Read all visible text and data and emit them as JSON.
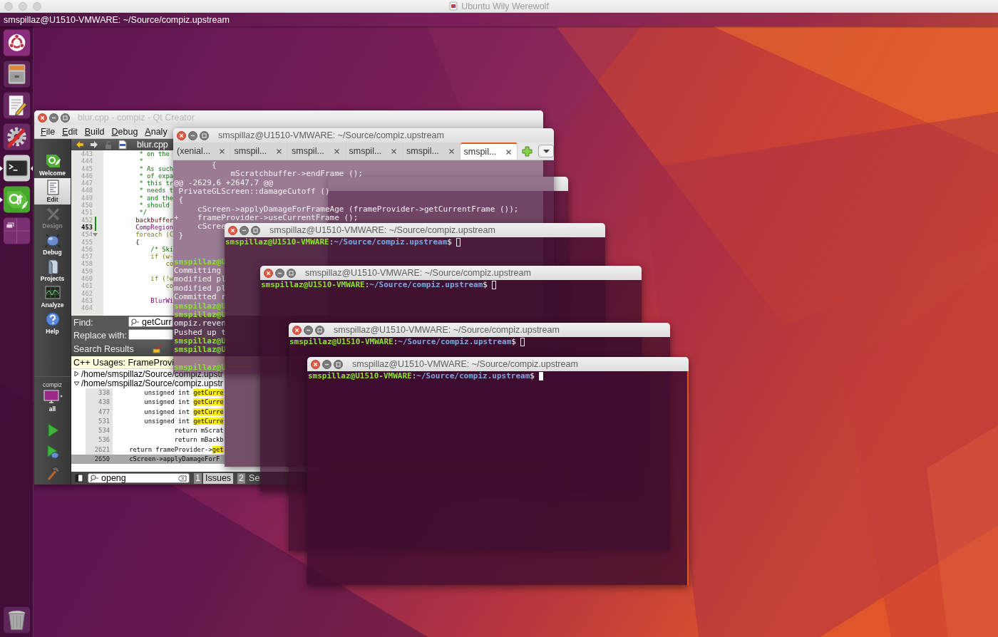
{
  "host_window": {
    "title": "Ubuntu Wily Werewolf"
  },
  "top_panel": {
    "title": "smspillaz@U1510-VMWARE: ~/Source/compiz.upstream"
  },
  "launcher": {
    "items": [
      {
        "kind": "ubuntu",
        "running": false,
        "focused": false
      },
      {
        "kind": "files",
        "running": false,
        "focused": false
      },
      {
        "kind": "text_editor",
        "running": false,
        "focused": false
      },
      {
        "kind": "settings",
        "running": false,
        "focused": false
      },
      {
        "kind": "terminal",
        "running": true,
        "focused": true
      },
      {
        "kind": "qt",
        "running": true,
        "focused": false
      },
      {
        "kind": "workspaces",
        "running": false,
        "focused": false
      },
      {
        "kind": "trash",
        "running": false,
        "focused": false
      }
    ]
  },
  "windows": [
    {
      "kind": "qt_creator",
      "title": "blur.cpp - compiz - Qt Creator",
      "menu": [
        "File",
        "Edit",
        "Build",
        "Debug",
        "Analy"
      ],
      "modes": [
        {
          "kind": "welcome",
          "label": "Welcome",
          "selected": false,
          "disabled": false
        },
        {
          "kind": "edit",
          "label": "Edit",
          "selected": true,
          "disabled": false
        },
        {
          "kind": "design",
          "label": "Design",
          "selected": false,
          "disabled": true
        },
        {
          "kind": "debug",
          "label": "Debug",
          "selected": false,
          "disabled": false
        },
        {
          "kind": "projects",
          "label": "Projects",
          "selected": false,
          "disabled": false
        },
        {
          "kind": "analyze",
          "label": "Analyze",
          "selected": false,
          "disabled": false
        },
        {
          "kind": "help",
          "label": "Help",
          "selected": false,
          "disabled": false
        }
      ],
      "kit": {
        "project": "compiz",
        "build": "all"
      },
      "actions": [
        {
          "kind": "run"
        },
        {
          "kind": "debug_run"
        },
        {
          "kind": "build"
        }
      ],
      "editor": {
        "file": "blur.cpp",
        "lines": [
          {
            "number": "443",
            "text": "     * on the",
            "kind": "comment",
            "current": false,
            "changed": false,
            "foldable": false
          },
          {
            "number": "444",
            "text": "     *",
            "kind": "comment",
            "current": false,
            "changed": false,
            "foldable": false
          },
          {
            "number": "445",
            "text": "     * As such",
            "kind": "comment",
            "current": false,
            "changed": false,
            "foldable": false
          },
          {
            "number": "446",
            "text": "     * of expa",
            "kind": "comment",
            "current": false,
            "changed": false,
            "foldable": false
          },
          {
            "number": "447",
            "text": "     * this tr",
            "kind": "comment",
            "current": false,
            "changed": false,
            "foldable": false
          },
          {
            "number": "448",
            "text": "     * needs t",
            "kind": "comment",
            "current": false,
            "changed": false,
            "foldable": false
          },
          {
            "number": "449",
            "text": "     * and the",
            "kind": "comment",
            "current": false,
            "changed": false,
            "foldable": false
          },
          {
            "number": "450",
            "text": "     * should",
            "kind": "comment",
            "current": false,
            "changed": false,
            "foldable": false
          },
          {
            "number": "451",
            "text": "     */",
            "kind": "comment",
            "current": false,
            "changed": false,
            "foldable": false
          },
          {
            "number": "452",
            "text": "    backbuffer",
            "kind": "member",
            "current": false,
            "changed": true,
            "foldable": false
          },
          {
            "number": "453",
            "text": "    CompRegion",
            "kind": "type",
            "current": true,
            "changed": true,
            "foldable": false
          },
          {
            "number": "454",
            "text": "    foreach (C",
            "kind": "keyword",
            "current": false,
            "changed": false,
            "foldable": true
          },
          {
            "number": "455",
            "text": "    {",
            "kind": "plain",
            "current": false,
            "changed": false,
            "foldable": false
          },
          {
            "number": "456",
            "text": "        /* Ski",
            "kind": "comment",
            "current": false,
            "changed": false,
            "foldable": false
          },
          {
            "number": "457",
            "text": "        if (w-",
            "kind": "keyword",
            "current": false,
            "changed": false,
            "foldable": false
          },
          {
            "number": "458",
            "text": "            co",
            "kind": "keyword",
            "current": false,
            "changed": false,
            "foldable": false
          },
          {
            "number": "459",
            "kind": "plain",
            "current": false,
            "changed": false,
            "foldable": false
          },
          {
            "number": "460",
            "text": "        if (!w",
            "kind": "keyword",
            "current": false,
            "changed": false,
            "foldable": false
          },
          {
            "number": "461",
            "text": "            co",
            "kind": "keyword",
            "current": false,
            "changed": false,
            "foldable": false
          },
          {
            "number": "462",
            "kind": "plain",
            "current": false,
            "changed": false,
            "foldable": false
          },
          {
            "number": "463",
            "text": "        BlurWi",
            "kind": "type",
            "current": false,
            "changed": false,
            "foldable": false
          },
          {
            "number": "464",
            "kind": "plain",
            "current": false,
            "changed": false,
            "foldable": false
          }
        ]
      },
      "find": {
        "label": "Find:",
        "value": "getCurr"
      },
      "replace": {
        "label": "Replace with:"
      },
      "search_results": {
        "title": "Search Results",
        "query": "C++ Usages: FrameProvi",
        "files": [
          {
            "path": "/home/smspillaz/Source/compiz.upstr",
            "expanded": false
          },
          {
            "path": "/home/smspillaz/Source/compiz.upstr",
            "expanded": true,
            "matches": [
              {
                "line": "338",
                "code": "        unsigned int ",
                "match": "getCurre",
                "selected": false
              },
              {
                "line": "438",
                "code": "        unsigned int ",
                "match": "getCurre",
                "selected": false
              },
              {
                "line": "477",
                "code": "        unsigned int ",
                "match": "getCurre",
                "selected": false
              },
              {
                "line": "531",
                "code": "        unsigned int ",
                "match": "getCurre",
                "selected": false
              },
              {
                "line": "534",
                "code": "                return mScrat",
                "selected": false
              },
              {
                "line": "536",
                "code": "                return mBackb",
                "selected": false
              },
              {
                "line": "2621",
                "code": "    return frameProvider->",
                "match": "get",
                "selected": false
              },
              {
                "line": "2650",
                "code": "    cScreen->applyDamageForF",
                "selected": true
              }
            ]
          }
        ]
      },
      "output_bar": {
        "filter": "openg",
        "panes": [
          {
            "number": "1",
            "label": "Issues",
            "selected": true
          },
          {
            "number": "2",
            "label": "Se",
            "selected": false
          }
        ]
      }
    },
    {
      "kind": "frame"
    },
    {
      "kind": "tabbed_terminal",
      "title": "smspillaz@U1510-VMWARE: ~/Source/compiz.upstream",
      "tabs": [
        {
          "label": "(xenial...",
          "selected": false
        },
        {
          "label": "smspil...",
          "selected": false
        },
        {
          "label": "smspil...",
          "selected": false
        },
        {
          "label": "smspil...",
          "selected": false
        },
        {
          "label": "smspil...",
          "selected": false
        },
        {
          "label": "smspil...",
          "selected": true
        }
      ],
      "lines": [
        {
          "kind": "output",
          "text": "        {"
        },
        {
          "kind": "output",
          "text": "            mScratchbuffer->endFrame ();"
        },
        {
          "kind": "output",
          "text": "@@ -2629,6 +2647,7 @@"
        },
        {
          "kind": "output",
          "text": " PrivateGLScreen::damageCutoff ()"
        },
        {
          "kind": "output",
          "text": " {"
        },
        {
          "kind": "output",
          "text": "     cScreen->applyDamageForFrameAge (frameProvider->getCurrentFrame ());"
        },
        {
          "kind": "output",
          "text": "+    frameProvider->useCurrentFrame ();"
        },
        {
          "kind": "output",
          "text": "     cScree"
        },
        {
          "kind": "output",
          "text": " }"
        },
        {
          "kind": "blank"
        },
        {
          "kind": "blank"
        },
        {
          "kind": "prompt",
          "text": "smspillaz@U"
        },
        {
          "kind": "output",
          "text": "Committing"
        },
        {
          "kind": "output",
          "text": "modified pl"
        },
        {
          "kind": "output",
          "text": "modified pl"
        },
        {
          "kind": "output",
          "text": "Committed r"
        },
        {
          "kind": "prompt",
          "text": "smspillaz@U"
        },
        {
          "kind": "prompt",
          "text": "smspillaz@U"
        },
        {
          "kind": "output",
          "text": "ompiz.reven"
        },
        {
          "kind": "output",
          "text": "Pushed up t"
        },
        {
          "kind": "prompt",
          "text": "smspillaz@U"
        },
        {
          "kind": "prompt",
          "text": "smspillaz@U"
        },
        {
          "kind": "blank"
        },
        {
          "kind": "prompt",
          "text": "smspillaz@U"
        }
      ]
    },
    {
      "kind": "terminal",
      "title": "smspillaz@U1510-VMWARE: ~/Source/compiz.upstream",
      "prompt": {
        "user": "smspillaz@U1510-VMWARE",
        "separator": ":",
        "path": "~/Source/compiz.upstream",
        "sign": "$"
      },
      "focused": false
    },
    {
      "kind": "terminal",
      "title": "smspillaz@U1510-VMWARE: ~/Source/compiz.upstream",
      "prompt": {
        "user": "smspillaz@U1510-VMWARE",
        "separator": ":",
        "path": "~/Source/compiz.upstream",
        "sign": "$"
      },
      "focused": false
    },
    {
      "kind": "terminal",
      "title": "smspillaz@U1510-VMWARE: ~/Source/compiz.upstream",
      "prompt": {
        "user": "smspillaz@U1510-VMWARE",
        "separator": ":",
        "path": "~/Source/compiz.upstream",
        "sign": "$"
      },
      "focused": false
    },
    {
      "kind": "terminal",
      "title": "smspillaz@U1510-VMWARE: ~/Source/compiz.upstream",
      "prompt": {
        "user": "smspillaz@U1510-VMWARE",
        "separator": ":",
        "path": "~/Source/compiz.upstream",
        "sign": "$"
      },
      "focused": true
    }
  ]
}
